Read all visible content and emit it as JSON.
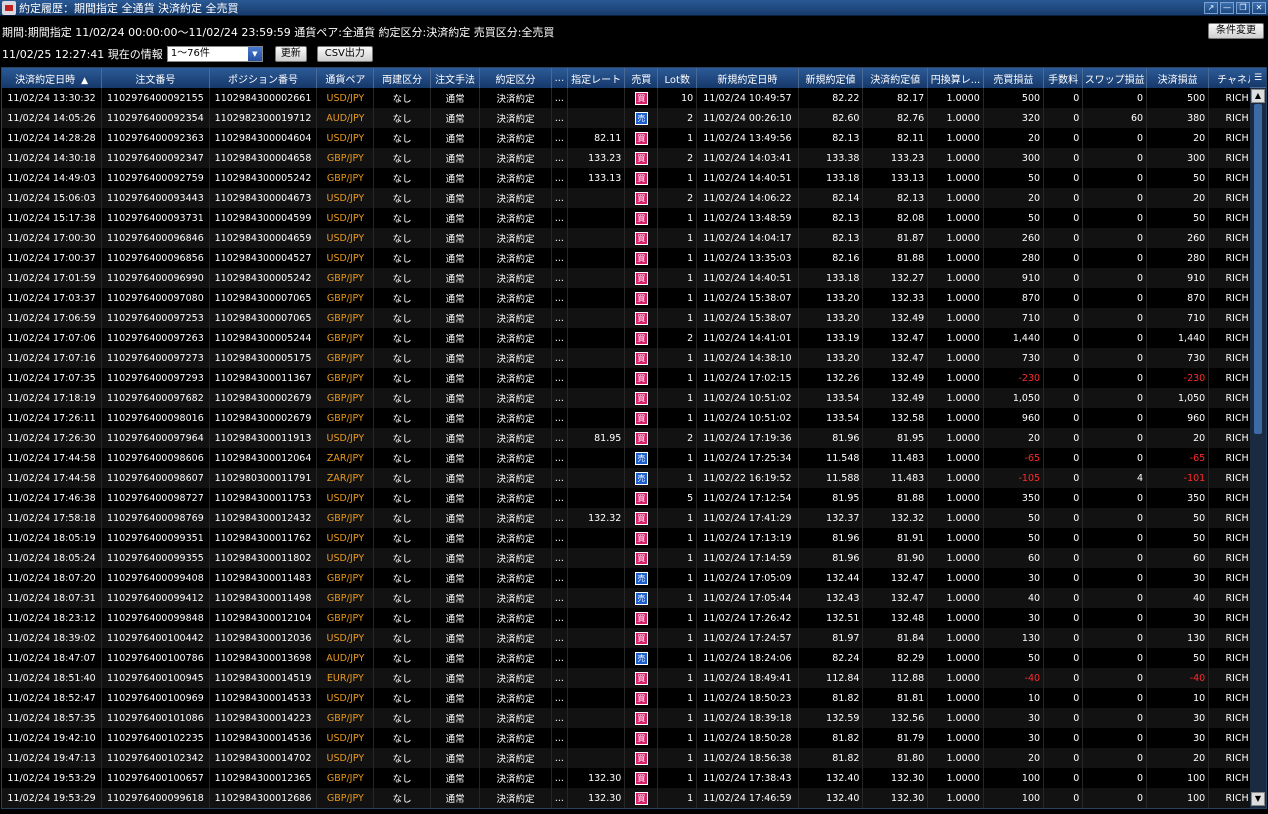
{
  "window": {
    "title": "約定履歴：期間指定 全通貨 決済約定 全売買"
  },
  "info": {
    "text": "期間:期間指定 11/02/24 00:00:00〜11/02/24 23:59:59 通貨ペア:全通貨 約定区分:決済約定 売買区分:全売買"
  },
  "toolbar": {
    "condition_button": "条件変更",
    "timestamp_label": "11/02/25 12:27:41 現在の情報",
    "range_select": "1〜76件",
    "refresh_button": "更新",
    "csv_button": "CSV出力"
  },
  "columns": [
    "決済約定日時",
    "注文番号",
    "ポジション番号",
    "通貨ペア",
    "両建区分",
    "注文手法",
    "約定区分",
    "...",
    "指定レート",
    "売買",
    "Lot数",
    "新規約定日時",
    "新規約定値",
    "決済約定値",
    "円換算レ...",
    "売買損益",
    "手数料",
    "スワップ損益",
    "決済損益",
    "チャネル"
  ],
  "sort_indicator": "▲",
  "rows": [
    [
      "11/02/24 13:30:32",
      "1102976400092155",
      "1102984300002661",
      "USD/JPY",
      "なし",
      "通常",
      "決済約定",
      "...",
      "",
      "買",
      "10",
      "11/02/24 10:49:57",
      "82.22",
      "82.17",
      "1.0000",
      "500",
      "0",
      "0",
      "500",
      "RICH"
    ],
    [
      "11/02/24 14:05:26",
      "1102976400092354",
      "1102982300019712",
      "AUD/JPY",
      "なし",
      "通常",
      "決済約定",
      "...",
      "",
      "売",
      "2",
      "11/02/24 00:26:10",
      "82.60",
      "82.76",
      "1.0000",
      "320",
      "0",
      "60",
      "380",
      "RICH"
    ],
    [
      "11/02/24 14:28:28",
      "1102976400092363",
      "1102984300004604",
      "USD/JPY",
      "なし",
      "通常",
      "決済約定",
      "...",
      "82.11",
      "買",
      "1",
      "11/02/24 13:49:56",
      "82.13",
      "82.11",
      "1.0000",
      "20",
      "0",
      "0",
      "20",
      "RICH"
    ],
    [
      "11/02/24 14:30:18",
      "1102976400092347",
      "1102984300004658",
      "GBP/JPY",
      "なし",
      "通常",
      "決済約定",
      "...",
      "133.23",
      "買",
      "2",
      "11/02/24 14:03:41",
      "133.38",
      "133.23",
      "1.0000",
      "300",
      "0",
      "0",
      "300",
      "RICH"
    ],
    [
      "11/02/24 14:49:03",
      "1102976400092759",
      "1102984300005242",
      "GBP/JPY",
      "なし",
      "通常",
      "決済約定",
      "...",
      "133.13",
      "買",
      "1",
      "11/02/24 14:40:51",
      "133.18",
      "133.13",
      "1.0000",
      "50",
      "0",
      "0",
      "50",
      "RICH"
    ],
    [
      "11/02/24 15:06:03",
      "1102976400093443",
      "1102984300004673",
      "USD/JPY",
      "なし",
      "通常",
      "決済約定",
      "...",
      "",
      "買",
      "2",
      "11/02/24 14:06:22",
      "82.14",
      "82.13",
      "1.0000",
      "20",
      "0",
      "0",
      "20",
      "RICH"
    ],
    [
      "11/02/24 15:17:38",
      "1102976400093731",
      "1102984300004599",
      "USD/JPY",
      "なし",
      "通常",
      "決済約定",
      "...",
      "",
      "買",
      "1",
      "11/02/24 13:48:59",
      "82.13",
      "82.08",
      "1.0000",
      "50",
      "0",
      "0",
      "50",
      "RICH"
    ],
    [
      "11/02/24 17:00:30",
      "1102976400096846",
      "1102984300004659",
      "USD/JPY",
      "なし",
      "通常",
      "決済約定",
      "...",
      "",
      "買",
      "1",
      "11/02/24 14:04:17",
      "82.13",
      "81.87",
      "1.0000",
      "260",
      "0",
      "0",
      "260",
      "RICH"
    ],
    [
      "11/02/24 17:00:37",
      "1102976400096856",
      "1102984300004527",
      "USD/JPY",
      "なし",
      "通常",
      "決済約定",
      "...",
      "",
      "買",
      "1",
      "11/02/24 13:35:03",
      "82.16",
      "81.88",
      "1.0000",
      "280",
      "0",
      "0",
      "280",
      "RICH"
    ],
    [
      "11/02/24 17:01:59",
      "1102976400096990",
      "1102984300005242",
      "GBP/JPY",
      "なし",
      "通常",
      "決済約定",
      "...",
      "",
      "買",
      "1",
      "11/02/24 14:40:51",
      "133.18",
      "132.27",
      "1.0000",
      "910",
      "0",
      "0",
      "910",
      "RICH"
    ],
    [
      "11/02/24 17:03:37",
      "1102976400097080",
      "1102984300007065",
      "GBP/JPY",
      "なし",
      "通常",
      "決済約定",
      "...",
      "",
      "買",
      "1",
      "11/02/24 15:38:07",
      "133.20",
      "132.33",
      "1.0000",
      "870",
      "0",
      "0",
      "870",
      "RICH"
    ],
    [
      "11/02/24 17:06:59",
      "1102976400097253",
      "1102984300007065",
      "GBP/JPY",
      "なし",
      "通常",
      "決済約定",
      "...",
      "",
      "買",
      "1",
      "11/02/24 15:38:07",
      "133.20",
      "132.49",
      "1.0000",
      "710",
      "0",
      "0",
      "710",
      "RICH"
    ],
    [
      "11/02/24 17:07:06",
      "1102976400097263",
      "1102984300005244",
      "GBP/JPY",
      "なし",
      "通常",
      "決済約定",
      "...",
      "",
      "買",
      "2",
      "11/02/24 14:41:01",
      "133.19",
      "132.47",
      "1.0000",
      "1,440",
      "0",
      "0",
      "1,440",
      "RICH"
    ],
    [
      "11/02/24 17:07:16",
      "1102976400097273",
      "1102984300005175",
      "GBP/JPY",
      "なし",
      "通常",
      "決済約定",
      "...",
      "",
      "買",
      "1",
      "11/02/24 14:38:10",
      "133.20",
      "132.47",
      "1.0000",
      "730",
      "0",
      "0",
      "730",
      "RICH"
    ],
    [
      "11/02/24 17:07:35",
      "1102976400097293",
      "1102984300011367",
      "GBP/JPY",
      "なし",
      "通常",
      "決済約定",
      "...",
      "",
      "買",
      "1",
      "11/02/24 17:02:15",
      "132.26",
      "132.49",
      "1.0000",
      "-230",
      "0",
      "0",
      "-230",
      "RICH"
    ],
    [
      "11/02/24 17:18:19",
      "1102976400097682",
      "1102984300002679",
      "GBP/JPY",
      "なし",
      "通常",
      "決済約定",
      "...",
      "",
      "買",
      "1",
      "11/02/24 10:51:02",
      "133.54",
      "132.49",
      "1.0000",
      "1,050",
      "0",
      "0",
      "1,050",
      "RICH"
    ],
    [
      "11/02/24 17:26:11",
      "1102976400098016",
      "1102984300002679",
      "GBP/JPY",
      "なし",
      "通常",
      "決済約定",
      "...",
      "",
      "買",
      "1",
      "11/02/24 10:51:02",
      "133.54",
      "132.58",
      "1.0000",
      "960",
      "0",
      "0",
      "960",
      "RICH"
    ],
    [
      "11/02/24 17:26:30",
      "1102976400097964",
      "1102984300011913",
      "USD/JPY",
      "なし",
      "通常",
      "決済約定",
      "...",
      "81.95",
      "買",
      "2",
      "11/02/24 17:19:36",
      "81.96",
      "81.95",
      "1.0000",
      "20",
      "0",
      "0",
      "20",
      "RICH"
    ],
    [
      "11/02/24 17:44:58",
      "1102976400098606",
      "1102984300012064",
      "ZAR/JPY",
      "なし",
      "通常",
      "決済約定",
      "...",
      "",
      "売",
      "1",
      "11/02/24 17:25:34",
      "11.548",
      "11.483",
      "1.0000",
      "-65",
      "0",
      "0",
      "-65",
      "RICH"
    ],
    [
      "11/02/24 17:44:58",
      "1102976400098607",
      "1102980300011791",
      "ZAR/JPY",
      "なし",
      "通常",
      "決済約定",
      "...",
      "",
      "売",
      "1",
      "11/02/22 16:19:52",
      "11.588",
      "11.483",
      "1.0000",
      "-105",
      "0",
      "4",
      "-101",
      "RICH"
    ],
    [
      "11/02/24 17:46:38",
      "1102976400098727",
      "1102984300011753",
      "USD/JPY",
      "なし",
      "通常",
      "決済約定",
      "...",
      "",
      "買",
      "5",
      "11/02/24 17:12:54",
      "81.95",
      "81.88",
      "1.0000",
      "350",
      "0",
      "0",
      "350",
      "RICH"
    ],
    [
      "11/02/24 17:58:18",
      "1102976400098769",
      "1102984300012432",
      "GBP/JPY",
      "なし",
      "通常",
      "決済約定",
      "...",
      "132.32",
      "買",
      "1",
      "11/02/24 17:41:29",
      "132.37",
      "132.32",
      "1.0000",
      "50",
      "0",
      "0",
      "50",
      "RICH"
    ],
    [
      "11/02/24 18:05:19",
      "1102976400099351",
      "1102984300011762",
      "USD/JPY",
      "なし",
      "通常",
      "決済約定",
      "...",
      "",
      "買",
      "1",
      "11/02/24 17:13:19",
      "81.96",
      "81.91",
      "1.0000",
      "50",
      "0",
      "0",
      "50",
      "RICH"
    ],
    [
      "11/02/24 18:05:24",
      "1102976400099355",
      "1102984300011802",
      "USD/JPY",
      "なし",
      "通常",
      "決済約定",
      "...",
      "",
      "買",
      "1",
      "11/02/24 17:14:59",
      "81.96",
      "81.90",
      "1.0000",
      "60",
      "0",
      "0",
      "60",
      "RICH"
    ],
    [
      "11/02/24 18:07:20",
      "1102976400099408",
      "1102984300011483",
      "GBP/JPY",
      "なし",
      "通常",
      "決済約定",
      "...",
      "",
      "売",
      "1",
      "11/02/24 17:05:09",
      "132.44",
      "132.47",
      "1.0000",
      "30",
      "0",
      "0",
      "30",
      "RICH"
    ],
    [
      "11/02/24 18:07:31",
      "1102976400099412",
      "1102984300011498",
      "GBP/JPY",
      "なし",
      "通常",
      "決済約定",
      "...",
      "",
      "売",
      "1",
      "11/02/24 17:05:44",
      "132.43",
      "132.47",
      "1.0000",
      "40",
      "0",
      "0",
      "40",
      "RICH"
    ],
    [
      "11/02/24 18:23:12",
      "1102976400099848",
      "1102984300012104",
      "GBP/JPY",
      "なし",
      "通常",
      "決済約定",
      "...",
      "",
      "買",
      "1",
      "11/02/24 17:26:42",
      "132.51",
      "132.48",
      "1.0000",
      "30",
      "0",
      "0",
      "30",
      "RICH"
    ],
    [
      "11/02/24 18:39:02",
      "1102976400100442",
      "1102984300012036",
      "USD/JPY",
      "なし",
      "通常",
      "決済約定",
      "...",
      "",
      "買",
      "1",
      "11/02/24 17:24:57",
      "81.97",
      "81.84",
      "1.0000",
      "130",
      "0",
      "0",
      "130",
      "RICH"
    ],
    [
      "11/02/24 18:47:07",
      "1102976400100786",
      "1102984300013698",
      "AUD/JPY",
      "なし",
      "通常",
      "決済約定",
      "...",
      "",
      "売",
      "1",
      "11/02/24 18:24:06",
      "82.24",
      "82.29",
      "1.0000",
      "50",
      "0",
      "0",
      "50",
      "RICH"
    ],
    [
      "11/02/24 18:51:40",
      "1102976400100945",
      "1102984300014519",
      "EUR/JPY",
      "なし",
      "通常",
      "決済約定",
      "...",
      "",
      "買",
      "1",
      "11/02/24 18:49:41",
      "112.84",
      "112.88",
      "1.0000",
      "-40",
      "0",
      "0",
      "-40",
      "RICH"
    ],
    [
      "11/02/24 18:52:47",
      "1102976400100969",
      "1102984300014533",
      "USD/JPY",
      "なし",
      "通常",
      "決済約定",
      "...",
      "",
      "買",
      "1",
      "11/02/24 18:50:23",
      "81.82",
      "81.81",
      "1.0000",
      "10",
      "0",
      "0",
      "10",
      "RICH"
    ],
    [
      "11/02/24 18:57:35",
      "1102976400101086",
      "1102984300014223",
      "GBP/JPY",
      "なし",
      "通常",
      "決済約定",
      "...",
      "",
      "買",
      "1",
      "11/02/24 18:39:18",
      "132.59",
      "132.56",
      "1.0000",
      "30",
      "0",
      "0",
      "30",
      "RICH"
    ],
    [
      "11/02/24 19:42:10",
      "1102976400102235",
      "1102984300014536",
      "USD/JPY",
      "なし",
      "通常",
      "決済約定",
      "...",
      "",
      "買",
      "1",
      "11/02/24 18:50:28",
      "81.82",
      "81.79",
      "1.0000",
      "30",
      "0",
      "0",
      "30",
      "RICH"
    ],
    [
      "11/02/24 19:47:13",
      "1102976400102342",
      "1102984300014702",
      "USD/JPY",
      "なし",
      "通常",
      "決済約定",
      "...",
      "",
      "買",
      "1",
      "11/02/24 18:56:38",
      "81.82",
      "81.80",
      "1.0000",
      "20",
      "0",
      "0",
      "20",
      "RICH"
    ],
    [
      "11/02/24 19:53:29",
      "1102976400100657",
      "1102984300012365",
      "GBP/JPY",
      "なし",
      "通常",
      "決済約定",
      "...",
      "132.30",
      "買",
      "1",
      "11/02/24 17:38:43",
      "132.40",
      "132.30",
      "1.0000",
      "100",
      "0",
      "0",
      "100",
      "RICH"
    ],
    [
      "11/02/24 19:53:29",
      "1102976400099618",
      "1102984300012686",
      "GBP/JPY",
      "なし",
      "通常",
      "決済約定",
      "...",
      "132.30",
      "買",
      "1",
      "11/02/24 17:46:59",
      "132.40",
      "132.30",
      "1.0000",
      "100",
      "0",
      "0",
      "100",
      "RICH"
    ]
  ],
  "colors": {
    "buy": "#d6246c",
    "sell": "#1c5fcc",
    "pair": "#e89a20",
    "negative": "#ff2a2a"
  }
}
